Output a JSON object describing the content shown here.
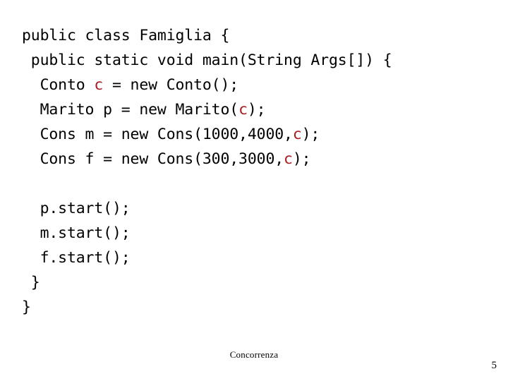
{
  "slide": {
    "footer_label": "Concorrenza",
    "page_number": "5",
    "accent_color": "#a81d21",
    "background_color": "#ffffff",
    "text_color": "#000000"
  },
  "code": {
    "language": "java",
    "lines": [
      {
        "id": "line-1",
        "text": "public class Famiglia {",
        "segments": [
          {
            "t": "public class Famiglia {",
            "c": "plain"
          }
        ]
      },
      {
        "id": "line-2",
        "text": " public static void main(String Args[]) {",
        "segments": [
          {
            "t": " public static void main(String Args[]) {",
            "c": "plain"
          }
        ]
      },
      {
        "id": "line-3",
        "text": "  Conto c = new Conto();",
        "segments": [
          {
            "t": "  Conto ",
            "c": "plain"
          },
          {
            "t": "c",
            "c": "accent"
          },
          {
            "t": " = new Conto();",
            "c": "plain"
          }
        ]
      },
      {
        "id": "line-4",
        "text": "  Marito p = new Marito(c);",
        "segments": [
          {
            "t": "  Marito p = new Marito(",
            "c": "plain"
          },
          {
            "t": "c",
            "c": "accent"
          },
          {
            "t": ");",
            "c": "plain"
          }
        ]
      },
      {
        "id": "line-5",
        "text": "  Cons m = new Cons(1000,4000,c);",
        "segments": [
          {
            "t": "  Cons m = new Cons(1000,4000,",
            "c": "plain"
          },
          {
            "t": "c",
            "c": "accent"
          },
          {
            "t": ");",
            "c": "plain"
          }
        ]
      },
      {
        "id": "line-6",
        "text": "  Cons f = new Cons(300,3000,c);",
        "segments": [
          {
            "t": "  Cons f = new Cons(300,3000,",
            "c": "plain"
          },
          {
            "t": "c",
            "c": "accent"
          },
          {
            "t": ");",
            "c": "plain"
          }
        ]
      },
      {
        "id": "line-7",
        "text": "",
        "segments": [
          {
            "t": "",
            "c": "plain"
          }
        ]
      },
      {
        "id": "line-8",
        "text": "  p.start();",
        "segments": [
          {
            "t": "  p.start();",
            "c": "plain"
          }
        ]
      },
      {
        "id": "line-9",
        "text": "  m.start();",
        "segments": [
          {
            "t": "  m.start();",
            "c": "plain"
          }
        ]
      },
      {
        "id": "line-10",
        "text": "  f.start();",
        "segments": [
          {
            "t": "  f.start();",
            "c": "plain"
          }
        ]
      },
      {
        "id": "line-11",
        "text": " }",
        "segments": [
          {
            "t": " }",
            "c": "plain"
          }
        ]
      },
      {
        "id": "line-12",
        "text": "}",
        "segments": [
          {
            "t": "}",
            "c": "plain"
          }
        ]
      }
    ]
  }
}
